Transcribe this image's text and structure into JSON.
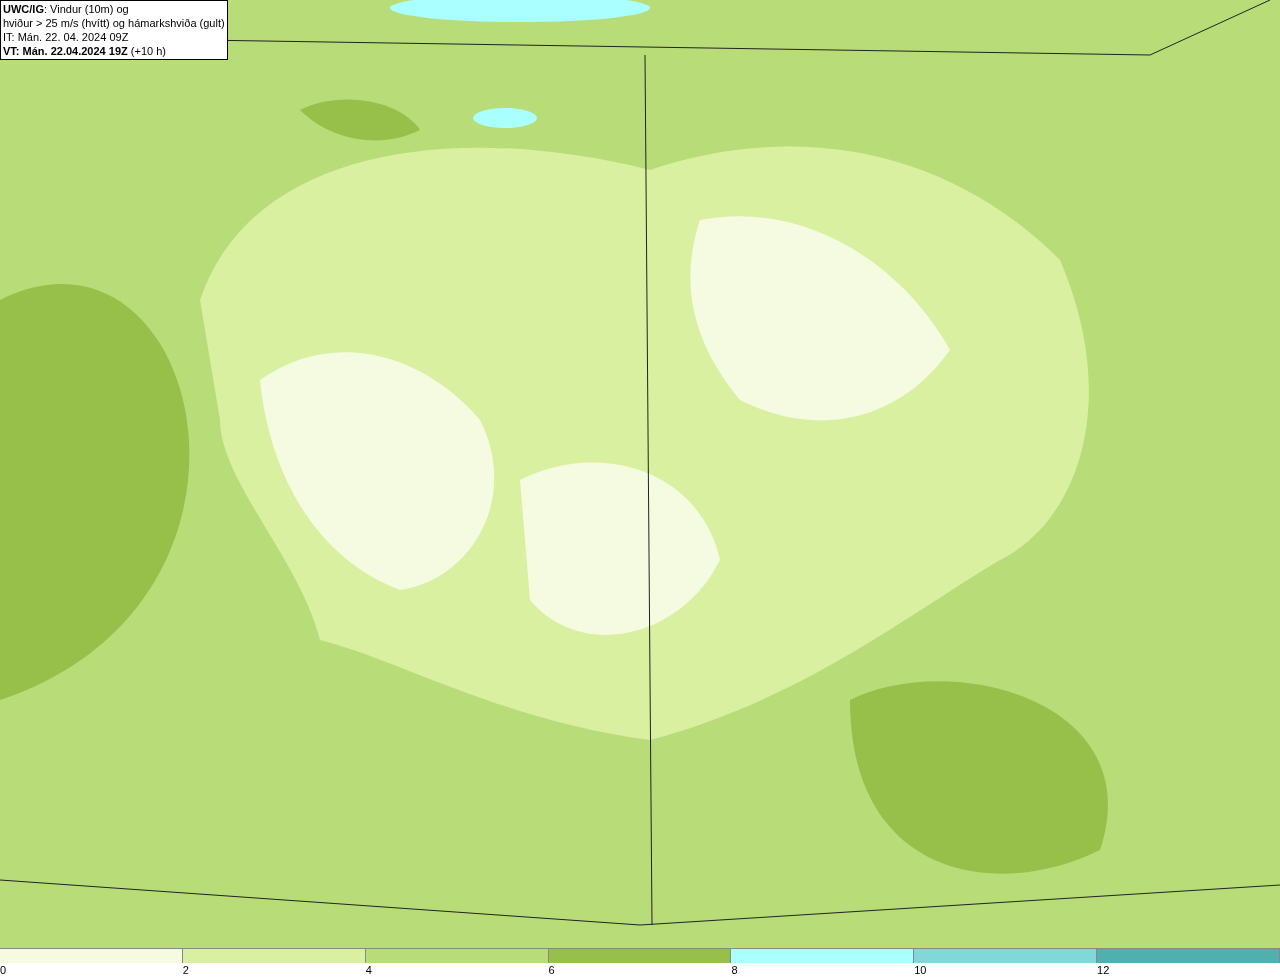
{
  "title_box": {
    "lines": [
      "**UWC/IG**: Vindur (10m) og",
      "hviður > 25 m/s (hvítt) og hámarkshviða (gult)",
      "IT: Mán. 22. 04. 2024 09Z",
      "**VT: Mán. 22.04.2024 19Z** (+10 h)"
    ]
  },
  "legend": {
    "segments": [
      {
        "color": "#f5fbe0"
      },
      {
        "color": "#d8f0a0"
      },
      {
        "color": "#b8dc78"
      },
      {
        "color": "#96c04a"
      },
      {
        "color": "#aaffff"
      },
      {
        "color": "#80d8d8"
      },
      {
        "color": "#50b0b0"
      }
    ],
    "labels": [
      "0",
      "2",
      "4",
      "6",
      "8",
      "10",
      "12"
    ]
  }
}
